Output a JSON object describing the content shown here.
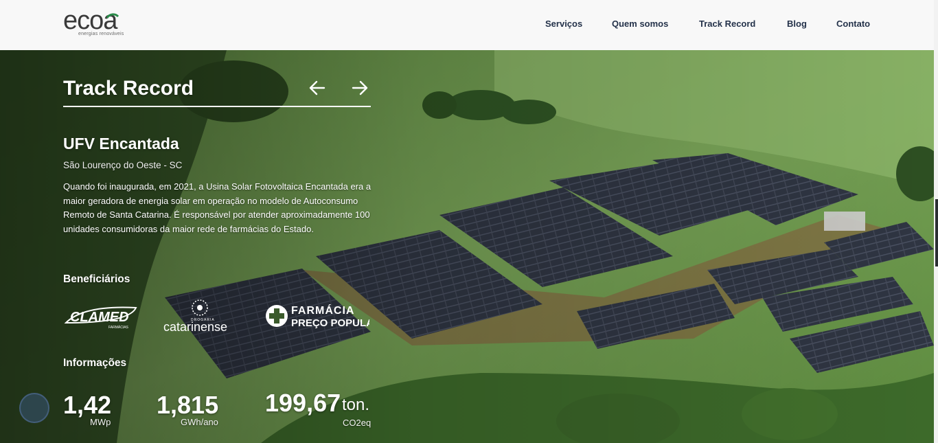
{
  "header": {
    "logo_text": "ecoa",
    "logo_tagline": "energias renováveis",
    "nav": [
      {
        "label": "Serviços"
      },
      {
        "label": "Quem somos"
      },
      {
        "label": "Track Record"
      },
      {
        "label": "Blog"
      },
      {
        "label": "Contato"
      }
    ]
  },
  "track_record": {
    "title": "Track Record",
    "prev_icon": "arrow-left-icon",
    "next_icon": "arrow-right-icon"
  },
  "project": {
    "name": "UFV Encantada",
    "location": "São Lourenço do Oeste - SC",
    "description": "Quando foi inaugurada, em 2021, a Usina Solar Fotovoltaica Encantada era a maior geradora de energia solar em operação no modelo de Autoconsumo Remoto de Santa Catarina. É responsável por atender aproximadamente 100 unidades consumidoras da maior rede de farmácias do Estado."
  },
  "beneficiaries": {
    "heading": "Beneficiários",
    "logos": [
      {
        "name": "CLAMED",
        "sub": "FARMÁCIAS"
      },
      {
        "name": "catarinense",
        "sub": "DROGARIA"
      },
      {
        "name": "FARMÁCIA",
        "sub": "PREÇO POPULAR"
      }
    ]
  },
  "info": {
    "heading": "Informações",
    "stats": [
      {
        "value": "1,42",
        "unit": "MWp"
      },
      {
        "value": "1,815",
        "unit": "GWh/ano"
      },
      {
        "value": "199,67",
        "unit_prefix": "ton.",
        "unit": "CO2eq"
      }
    ]
  },
  "colors": {
    "nav_text": "#24324a",
    "logo": "#3a3a3a",
    "logo_accent": "#2a8c4a",
    "header_bg": "#f8f8f8"
  }
}
